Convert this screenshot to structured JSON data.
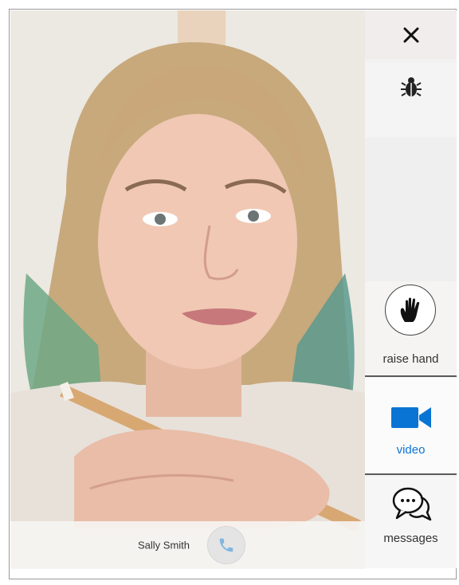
{
  "caller": {
    "name": "Sally Smith"
  },
  "sidebar": {
    "close_icon": "close-icon",
    "bug_icon": "bug-icon",
    "raise_hand": {
      "label": "raise hand",
      "icon": "hand-icon"
    },
    "video": {
      "label": "video",
      "icon": "video-camera-icon",
      "color": "#0a74d4"
    },
    "messages": {
      "label": "messages",
      "icon": "chat-bubbles-icon"
    }
  },
  "colors": {
    "accent": "#0a74d4",
    "call_icon": "#7fb6df"
  }
}
